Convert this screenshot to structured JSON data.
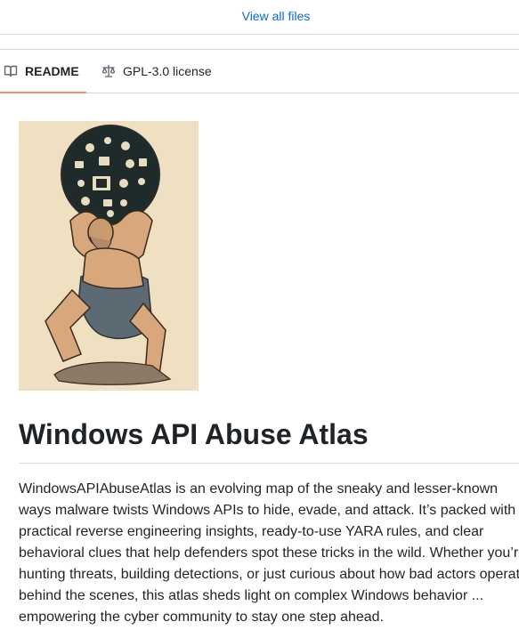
{
  "top": {
    "view_all_label": "View all files"
  },
  "tabs": [
    {
      "label": "README",
      "icon": "book-icon"
    },
    {
      "label": "GPL-3.0 license",
      "icon": "law-scale-icon"
    }
  ],
  "readme": {
    "title": "Windows API Abuse Atlas",
    "description_lines": [
      "WindowsAPIAbuseAtlas is an evolving map of the sneaky and lesser-known",
      "ways malware twists Windows APIs to hide, evade, and attack. It’s packed with",
      "practical reverse engineering insights, ready-to-use YARA rules, and clear",
      "behavioral clues that help defenders spot these tricks in the wild. Whether you’re",
      "hunting threats, building detections, or just curious about how bad actors operate",
      "behind the scenes, this atlas sheds light on complex Windows behavior ...",
      "empowering the cyber community to stay one step ahead."
    ]
  },
  "colors": {
    "link": "#0969da",
    "tab_underline": "#fd8c73",
    "border": "#d0d7de",
    "text": "#1f2328"
  }
}
